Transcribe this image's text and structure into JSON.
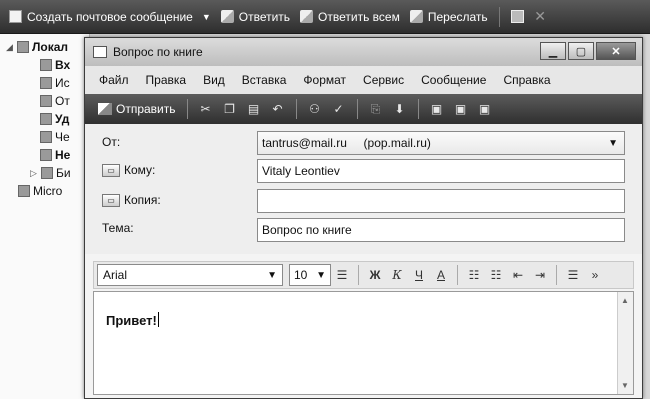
{
  "outer_toolbar": {
    "new_message": "Создать почтовое сообщение",
    "reply": "Ответить",
    "reply_all": "Ответить всем",
    "forward": "Переслать"
  },
  "folder_tree": {
    "items": [
      "Локал",
      "Вх",
      "Ис",
      "От",
      "Уд",
      "Че",
      "Не",
      "Би",
      "Micro"
    ]
  },
  "window": {
    "title": "Вопрос по книге",
    "menu": [
      "Файл",
      "Правка",
      "Вид",
      "Вставка",
      "Формат",
      "Сервис",
      "Сообщение",
      "Справка"
    ],
    "toolbar": {
      "send_label": "Отправить"
    },
    "header": {
      "from_label": "От:",
      "from_value": "tantrus@mail.ru     (pop.mail.ru)",
      "to_label": "Кому:",
      "to_value": "Vitaly Leontiev",
      "cc_label": "Копия:",
      "cc_value": "",
      "subject_label": "Тема:",
      "subject_value": "Вопрос по книге"
    },
    "format": {
      "font": "Arial",
      "size": "10",
      "bold": "Ж",
      "italic": "К",
      "underline": "Ч",
      "color": "А"
    },
    "body_text": "Привет!"
  }
}
